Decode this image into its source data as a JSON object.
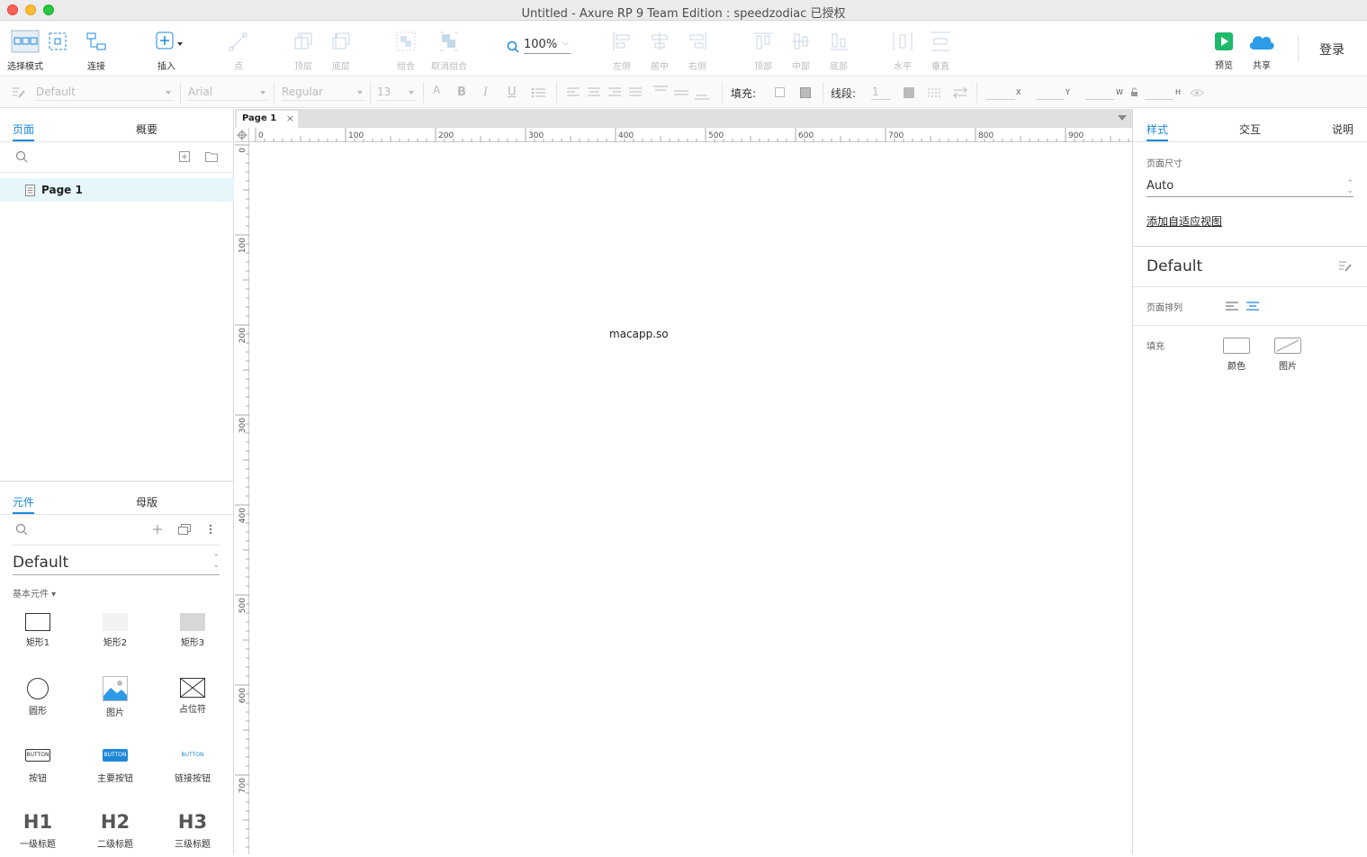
{
  "window": {
    "title": "Untitled - Axure RP 9 Team Edition : speedzodiac 已授权"
  },
  "toolbar": {
    "select_mode": "选择模式",
    "connect": "连接",
    "insert": "插入",
    "point": "点",
    "top_layer": "顶层",
    "bottom_layer": "底层",
    "group": "组合",
    "ungroup": "取消组合",
    "zoom": "100%",
    "align_left": "左侧",
    "align_center": "居中",
    "align_right": "右侧",
    "align_top": "顶部",
    "align_middle": "中部",
    "align_bottom": "底部",
    "distribute_h": "水平",
    "distribute_v": "垂直",
    "preview": "预览",
    "share": "共享",
    "login": "登录"
  },
  "formatbar": {
    "style": "Default",
    "font": "Arial",
    "weight": "Regular",
    "size": "13",
    "fill_label": "填充:",
    "stroke_label": "线段:",
    "stroke_width": "1",
    "x": "X",
    "y": "Y",
    "w": "W",
    "h": "H"
  },
  "pages_panel": {
    "tab_pages": "页面",
    "tab_outline": "概要",
    "pages": [
      {
        "label": "Page 1"
      }
    ]
  },
  "library_panel": {
    "tab_widgets": "元件",
    "tab_masters": "母版",
    "library": "Default",
    "category": "基本元件 ▾",
    "widgets": [
      {
        "label": "矩形1"
      },
      {
        "label": "矩形2"
      },
      {
        "label": "矩形3"
      },
      {
        "label": "圆形"
      },
      {
        "label": "图片"
      },
      {
        "label": "占位符"
      },
      {
        "label": "按钮"
      },
      {
        "label": "主要按钮"
      },
      {
        "label": "链接按钮"
      },
      {
        "label": "一级标题",
        "glyph": "H1"
      },
      {
        "label": "二级标题",
        "glyph": "H2"
      },
      {
        "label": "三级标题",
        "glyph": "H3"
      }
    ],
    "button_glyph": "BUTTON"
  },
  "canvas": {
    "tab": "Page 1",
    "tab_close": "×",
    "watermark": "macapp.so",
    "h_ticks": [
      "0",
      "100",
      "200",
      "300",
      "400",
      "500",
      "600",
      "700",
      "800",
      "900"
    ],
    "v_ticks": [
      "0",
      "100",
      "200",
      "300",
      "400",
      "500",
      "600",
      "700"
    ]
  },
  "right_panel": {
    "tab_style": "样式",
    "tab_interaction": "交互",
    "tab_notes": "说明",
    "page_size_label": "页面尺寸",
    "page_size_value": "Auto",
    "adaptive_link": "添加自适应视图",
    "style_name": "Default",
    "page_align_label": "页面排列",
    "fill_label": "填充",
    "fill_color": "颜色",
    "fill_image": "图片"
  },
  "colors": {
    "accent": "#1e88d8",
    "selected_row": "#e6f6fa",
    "preview_green": "#1fb96c",
    "share_blue": "#2d9be8"
  }
}
